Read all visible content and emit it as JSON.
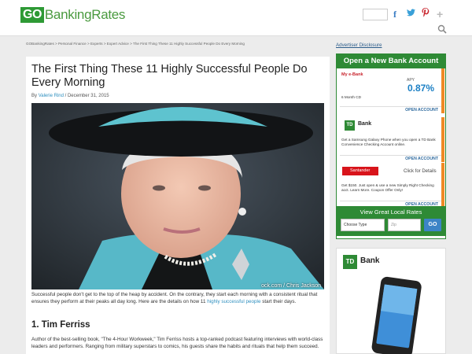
{
  "header": {
    "logo_go": "GO",
    "logo_rest": "BankingRates",
    "social": {
      "facebook": "f",
      "twitter": "t",
      "pinterest": "p",
      "googleplus": "+"
    }
  },
  "breadcrumb": "GOBankingRates > Personal Finance > Experts > Expert Advice > The First Thing These 11 Highly Successful People Do Every Morning",
  "article": {
    "title": "The First Thing These 11 Highly Successful People Do Every Morning",
    "by": "By",
    "author": "Valerie Rind",
    "date": "/ December 31, 2015",
    "photo_credit": "ock.com / Chris Jackson",
    "intro_before": "Successful people don't get to the top of the heap by accident. On the contrary, they start each morning with a consistent ritual that ensures they perform at their peaks all day long. Here are the details on how 11 ",
    "intro_link": "highly successful people",
    "intro_after": " start their days.",
    "section1_heading": "1. Tim Ferriss",
    "section1_text": "Author of the best-selling book, \"The 4-Hour Workweek,\" Tim Ferriss hosts a top-ranked podcast featuring interviews with world-class leaders and performers. Ranging from military superstars to comics, his guests share the habits and rituals that help them succeed."
  },
  "sidebar": {
    "advertiser_disclosure": "Advertiser Disclosure",
    "bank_box_title": "Open a New Bank Account",
    "offers": [
      {
        "brand": "My e-Bank",
        "apy_label": "APY",
        "rate": "0.87%",
        "desc": "6 Month CD",
        "cta": "OPEN ACCOUNT"
      },
      {
        "brand": "TD Bank",
        "logo": "TD",
        "desc": "Get a Samsung Galaxy Phone when you open a TD Bank Convenience Checking Account online.",
        "cta": "OPEN ACCOUNT"
      },
      {
        "brand": "Santander",
        "side": "Click for Details",
        "desc": "Get $150. Just open & use a new Simply Right Checking acct. Learn More. Coupon Offer Only!",
        "cta": "OPEN ACCOUNT"
      }
    ],
    "local": {
      "title": "View Great Local Rates",
      "type_value": "Choose Type",
      "zip_placeholder": "Zip",
      "go_label": "GO"
    },
    "ad": {
      "logo": "TD",
      "word": "Bank"
    }
  },
  "colors": {
    "brand_green": "#2e8a35",
    "accent_orange": "#f08a24",
    "link_blue": "#2e8fbf"
  }
}
